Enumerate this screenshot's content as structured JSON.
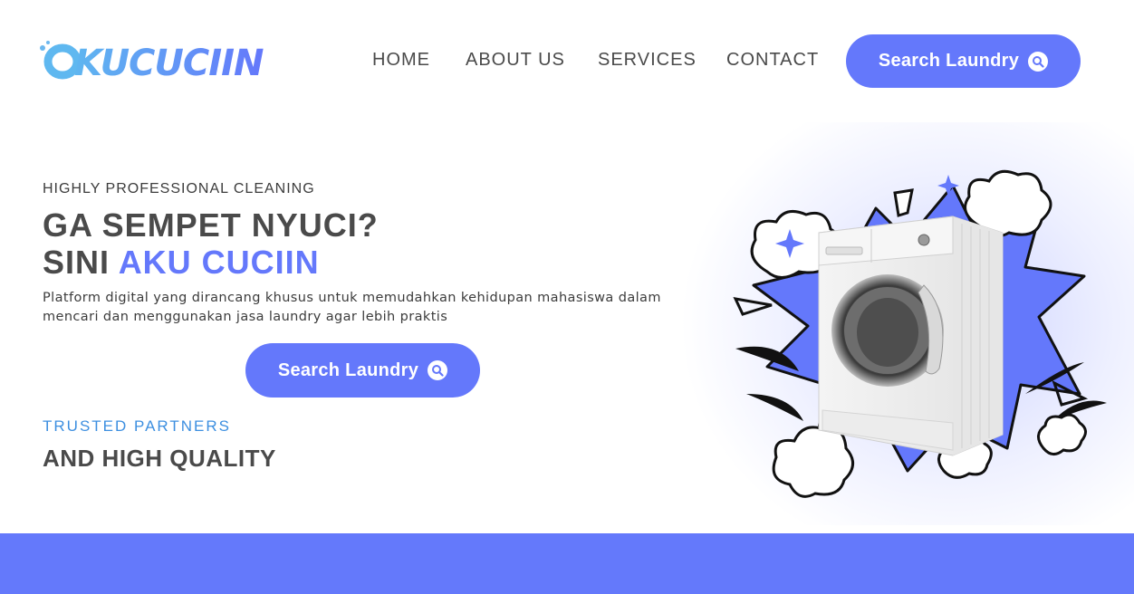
{
  "brand": {
    "logo_text": "KUCUCIIN",
    "accent_color": "#6478fb"
  },
  "nav": {
    "items": [
      {
        "label": "HOME"
      },
      {
        "label": "ABOUT US"
      },
      {
        "label": "SERVICES"
      },
      {
        "label": "CONTACT"
      }
    ],
    "cta_label": "Search Laundry",
    "cta_icon": "search-icon"
  },
  "hero": {
    "eyebrow": "HIGHLY PROFESSIONAL CLEANING",
    "headline_line1": "GA SEMPET NYUCI?",
    "headline_line2_prefix": "SINI ",
    "headline_line2_accent": "AKU CUCIIN",
    "description": "Platform digital yang dirancang khusus untuk memudahkan kehidupan mahasiswa dalam mencari dan menggunakan jasa laundry agar lebih praktis",
    "cta_label": "Search Laundry",
    "cta_icon": "search-icon",
    "trusted_label": "TRUSTED PARTNERS",
    "quality_label": "AND HIGH QUALITY"
  },
  "illustration": {
    "subject": "washing-machine",
    "colors": {
      "burst": "#6478fb",
      "sparkle": "#6478fb"
    }
  },
  "footer_band": {
    "color": "#6479fb"
  }
}
